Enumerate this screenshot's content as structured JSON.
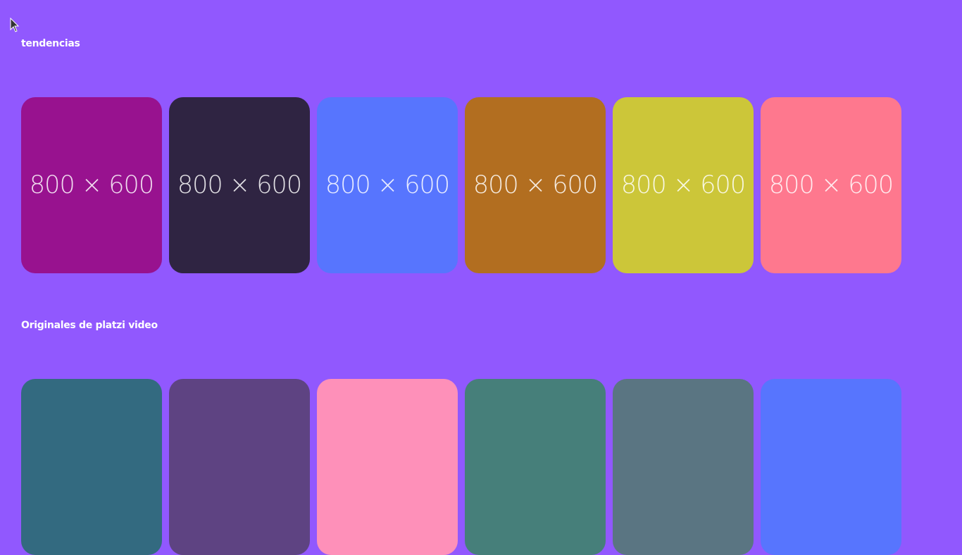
{
  "sections": [
    {
      "title": "tendencias",
      "cards": [
        {
          "label": "800 × 600",
          "color": "#98128f"
        },
        {
          "label": "800 × 600",
          "color": "#2f2442"
        },
        {
          "label": "800 × 600",
          "color": "#5775fe"
        },
        {
          "label": "800 × 600",
          "color": "#b26e20"
        },
        {
          "label": "800 × 600",
          "color": "#ccc639"
        },
        {
          "label": "800 × 600",
          "color": "#fe788e"
        }
      ]
    },
    {
      "title": "Originales de platzi video",
      "cards": [
        {
          "color": "#336a80"
        },
        {
          "color": "#5e4382"
        },
        {
          "color": "#fe90b9"
        },
        {
          "color": "#467f7a"
        },
        {
          "color": "#5a7582"
        },
        {
          "color": "#5775fe"
        }
      ]
    }
  ]
}
